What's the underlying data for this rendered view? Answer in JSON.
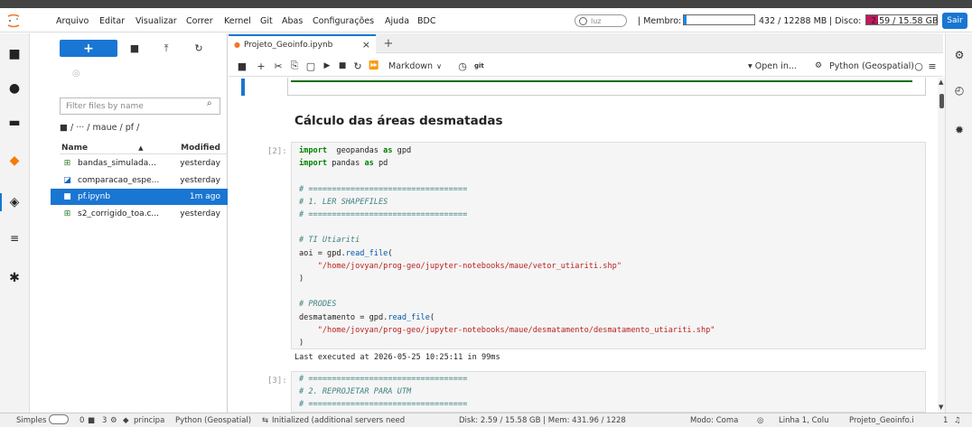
{
  "menubar": {
    "items": [
      "Arquivo",
      "Editar",
      "Visualizar",
      "Correr",
      "Kernel",
      "Git",
      "Abas",
      "Configurações",
      "Ajuda",
      "BDC"
    ],
    "kernel_status": "luz",
    "membro_label": "| Membro:",
    "membro_value": "432 / 12288 MB",
    "membro_fraction": 0.035,
    "disco_label": "| Disco:",
    "disco_value": "2.59 / 15.58 GB",
    "disco_fraction": 0.17,
    "logout_label": "Sair",
    "colors": {
      "accent": "#1976d2",
      "disk_fill": "#c2185b",
      "mem_fill": "#1e88e5"
    }
  },
  "activity_icons": [
    "folder-icon",
    "running-icon",
    "commands-icon",
    "git-icon",
    "extension-icon",
    "toc-icon",
    "puzzle-icon"
  ],
  "filebrowser": {
    "new_label": "+",
    "filter_placeholder": "Filter files by name",
    "breadcrumb": "■ / ··· / maue / pf /",
    "col_name": "Name",
    "col_sort": "▲",
    "col_modified": "Modified",
    "files": [
      {
        "name": "bandas_simulada...",
        "modified": "yesterday",
        "icon": "⊞",
        "color": "#2e7d32",
        "selected": false
      },
      {
        "name": "comparacao_espe...",
        "modified": "yesterday",
        "icon": "◪",
        "color": "#1565c0",
        "selected": false
      },
      {
        "name": "pf.ipynb",
        "modified": "1m ago",
        "icon": "■",
        "color": "#ffffff",
        "selected": true
      },
      {
        "name": "s2_corrigido_toa.c...",
        "modified": "yesterday",
        "icon": "⊞",
        "color": "#2e7d32",
        "selected": false
      }
    ]
  },
  "tab": {
    "label": "Projeto_Geoinfo.ipynb",
    "close": "×",
    "add": "+"
  },
  "toolbar": {
    "cell_type": "Markdown",
    "cell_type_arrow": "∨",
    "git_label": "git",
    "open_in": "▾ Open in...",
    "kernel_name": "Python (Geospatial)"
  },
  "notebook": {
    "section_title": "Cálculo das áreas desmatadas",
    "cell1_prompt": "[2]:",
    "cell1_lines": [
      [
        [
          "kw",
          "import"
        ],
        [
          "",
          "  geopandas "
        ],
        [
          "kw",
          "as"
        ],
        [
          "",
          " gpd"
        ]
      ],
      [
        [
          "kw",
          "import"
        ],
        [
          "",
          " pandas "
        ],
        [
          "kw",
          "as"
        ],
        [
          "",
          " pd"
        ]
      ],
      [
        [
          "",
          ""
        ]
      ],
      [
        [
          "cm",
          "# =================================="
        ]
      ],
      [
        [
          "cm",
          "# 1. LER SHAPEFILES"
        ]
      ],
      [
        [
          "cm",
          "# =================================="
        ]
      ],
      [
        [
          "",
          ""
        ]
      ],
      [
        [
          "cm",
          "# TI Utiariti"
        ]
      ],
      [
        [
          "",
          "aoi = gpd."
        ],
        [
          "fn",
          "read_file"
        ],
        [
          "",
          "("
        ]
      ],
      [
        [
          "st",
          "    \"/home/jovyan/prog-geo/jupyter-notebooks/maue/vetor_utiariti.shp\""
        ]
      ],
      [
        [
          "",
          ")"
        ]
      ],
      [
        [
          "",
          ""
        ]
      ],
      [
        [
          "cm",
          "# PRODES"
        ]
      ],
      [
        [
          "",
          "desmatamento = gpd."
        ],
        [
          "fn",
          "read_file"
        ],
        [
          "",
          "("
        ]
      ],
      [
        [
          "st",
          "    \"/home/jovyan/prog-geo/jupyter-notebooks/maue/desmatamento/desmatamento_utiariti.shp\""
        ]
      ],
      [
        [
          "",
          ")"
        ]
      ]
    ],
    "exec_info": "Last executed at 2026-05-25 10:25:11 in 99ms",
    "cell2_prompt": "[3]:",
    "cell2_lines": [
      [
        [
          "cm",
          "# =================================="
        ]
      ],
      [
        [
          "cm",
          "# 2. REPROJETAR PARA UTM"
        ]
      ],
      [
        [
          "cm",
          "# =================================="
        ]
      ]
    ]
  },
  "statusbar": {
    "mode_label": "Simples",
    "terminals": "0",
    "kernels": "3",
    "git_branch": "principa",
    "kernel": "Python (Geospatial)",
    "lsp": "Initialized (additional servers need",
    "resources": "Disk: 2.59 / 15.58 GB | Mem: 431.96 / 1228",
    "edit_mode": "Modo: Coma",
    "position": "Linha 1, Colu",
    "notebook": "Projeto_Geoinfo.i",
    "notif_count": "1"
  }
}
